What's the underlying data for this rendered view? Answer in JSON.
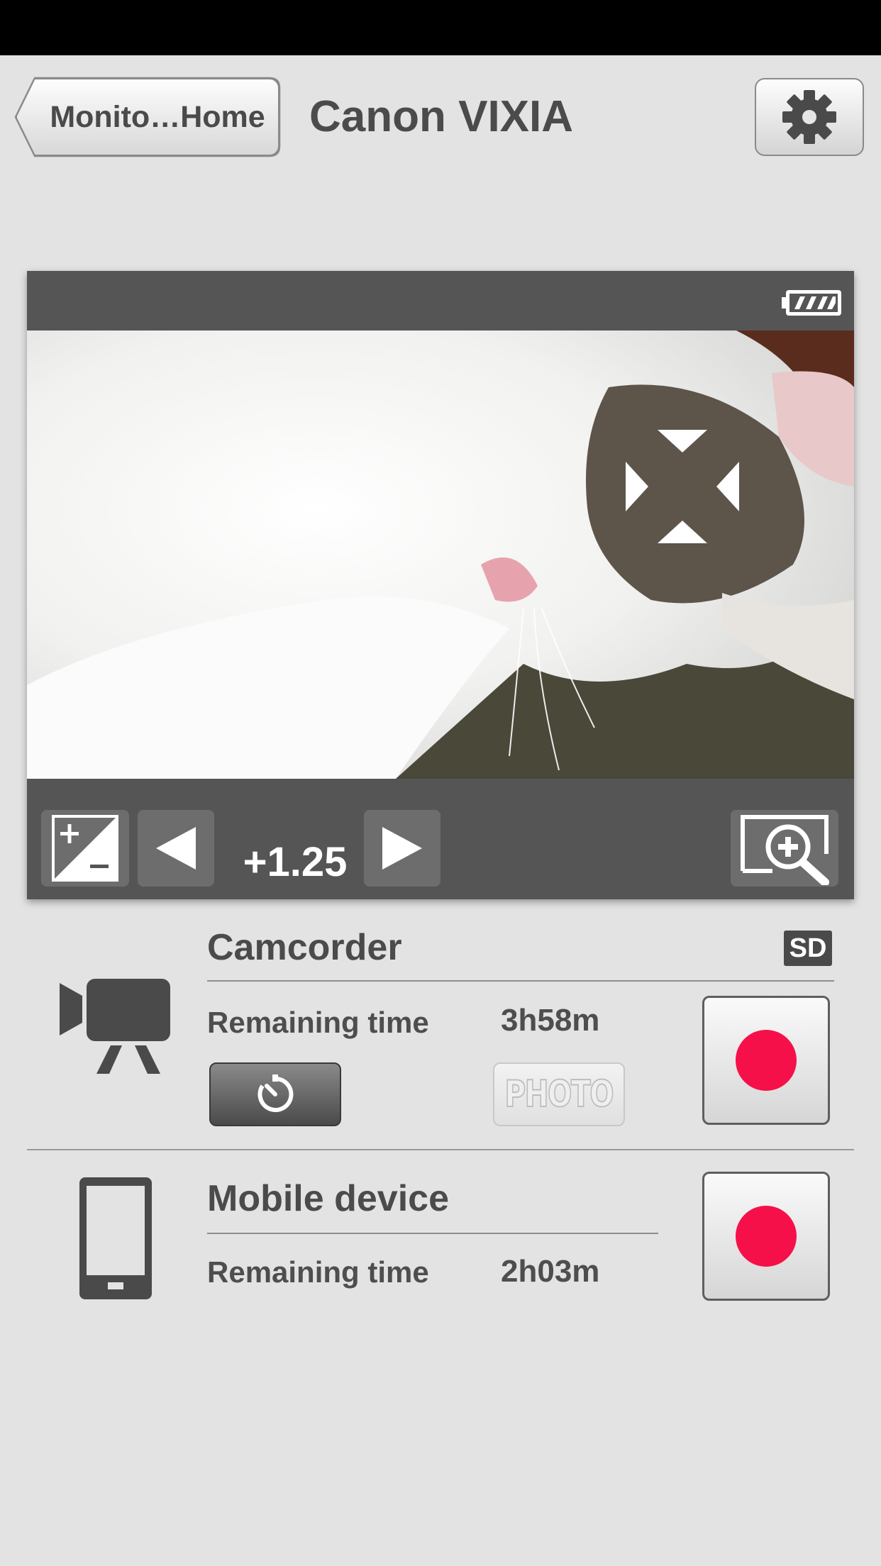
{
  "header": {
    "back_label": "Monito…Home",
    "title": "Canon VIXIA"
  },
  "preview": {
    "battery": "full",
    "exposure_value": "+1.25"
  },
  "camcorder": {
    "title": "Camcorder",
    "media_badge": "SD",
    "remaining_label": "Remaining time",
    "remaining_value": "3h58m",
    "photo_label": "PHOTO"
  },
  "mobile": {
    "title": "Mobile device",
    "remaining_label": "Remaining time",
    "remaining_value": "2h03m"
  },
  "colors": {
    "record": "#f6104a",
    "panel": "#555555",
    "background": "#e3e3e3"
  },
  "icons": [
    "gear-icon",
    "battery-icon",
    "focus-target-icon",
    "exposure-icon",
    "left-arrow-icon",
    "right-arrow-icon",
    "zoom-in-icon",
    "video-camera-icon",
    "self-timer-icon",
    "smartphone-icon"
  ]
}
